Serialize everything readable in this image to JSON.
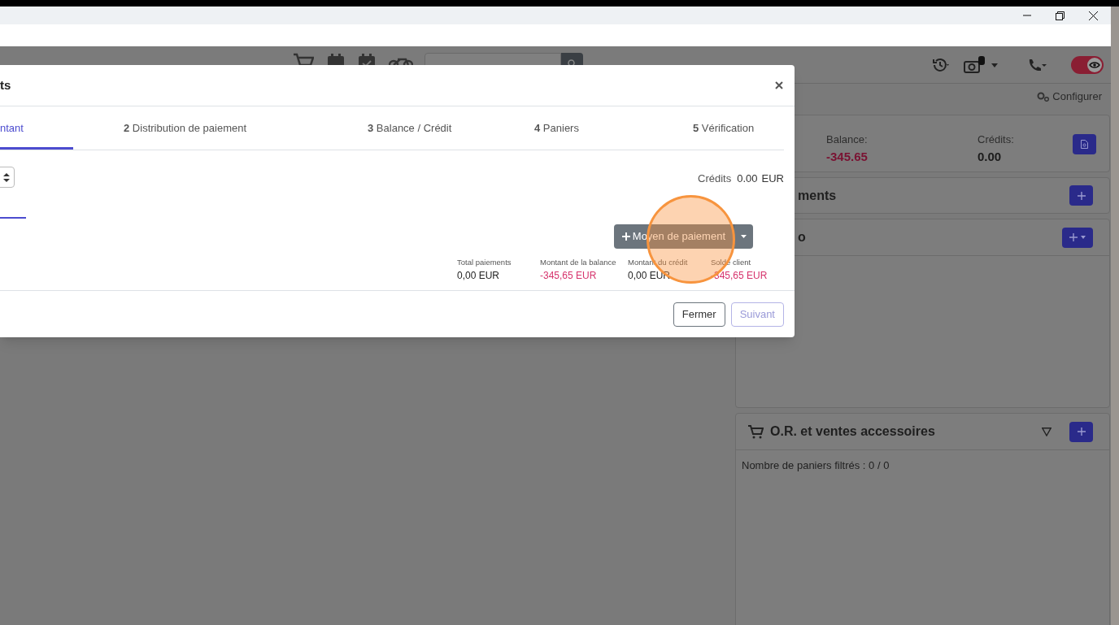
{
  "navbar": {
    "toggle": {
      "on": true
    }
  },
  "subbar": {
    "configure": "Configurer"
  },
  "summary": [
    {
      "label": "Balance:",
      "value": "-345.65",
      "negative": true
    },
    {
      "label": "Crédits:",
      "value": "0.00",
      "negative": false
    }
  ],
  "sections": [
    {
      "title": "ments",
      "cart_icon": false,
      "filter": false,
      "add_menu": false
    },
    {
      "title": "o",
      "cart_icon": false,
      "filter": false,
      "add_menu": true
    },
    {
      "title": "O.R. et ventes accessoires",
      "cart_icon": true,
      "filter": true,
      "add_menu": false,
      "body": "Nombre de paniers filtrés : 0 / 0"
    }
  ],
  "modal": {
    "title": "ts",
    "steps": [
      {
        "label": "ntant",
        "selected": true
      },
      {
        "number": "2",
        "label": "Distribution de paiement",
        "selected": false
      },
      {
        "number": "3",
        "label": "Balance / Crédit",
        "selected": false
      },
      {
        "number": "4",
        "label": "Paniers",
        "selected": false
      },
      {
        "number": "5",
        "label": "Vérification",
        "selected": false
      }
    ],
    "credits": {
      "label": "Crédits",
      "value": "0.00",
      "currency": "EUR"
    },
    "add_button": "Moyen de paiement",
    "totals": [
      {
        "label": "Total paiements",
        "value": "0,00 EUR",
        "negative": false
      },
      {
        "label": "Montant de la balance",
        "value": "-345,65 EUR",
        "negative": true
      },
      {
        "label": "Montant du crédit",
        "value": "0,00 EUR",
        "negative": false
      },
      {
        "label": "Solde client",
        "value": "-345,65 EUR",
        "negative": true
      }
    ],
    "buttons": [
      {
        "label": "Fermer",
        "disabled": false
      },
      {
        "label": "Suivant",
        "disabled": true
      }
    ]
  }
}
